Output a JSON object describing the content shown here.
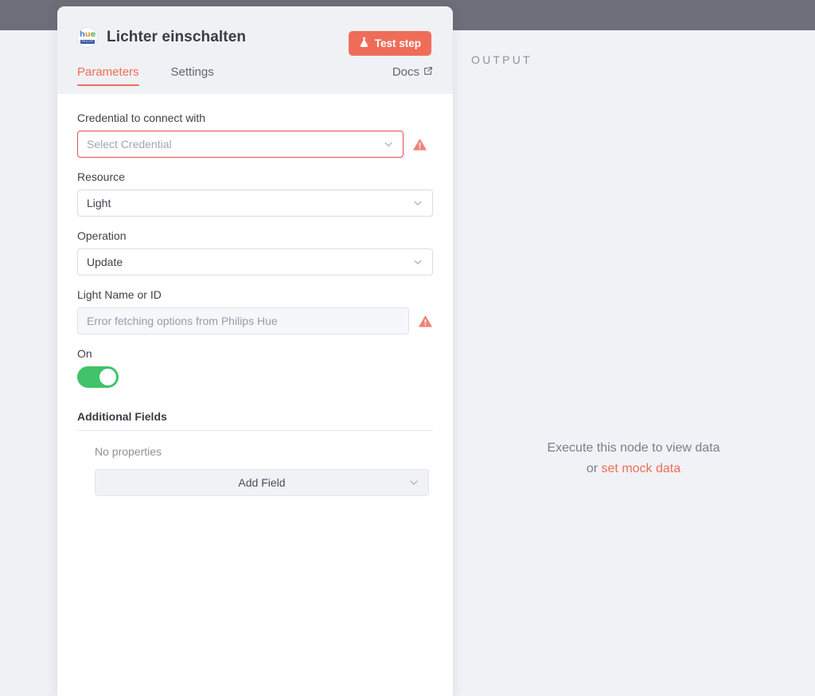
{
  "window": {
    "topbar_color": "#6e6e7a",
    "background_color": "#f0f1f5"
  },
  "node_panel": {
    "icon_name": "philips-hue-logo-icon",
    "logo_text": "hue",
    "logo_brand": "PHILIPS",
    "title": "Lichter einschalten",
    "test_step_label": "Test step",
    "test_step_color": "#ef6d58",
    "tabs": [
      {
        "label": "Parameters",
        "active": true
      },
      {
        "label": "Settings",
        "active": false
      }
    ],
    "docs_label": "Docs",
    "accent_color": "#ef6d58"
  },
  "parameters": {
    "credential": {
      "label": "Credential to connect with",
      "placeholder": "Select Credential",
      "value": "",
      "has_error": true,
      "error_color": "#ef4b4b"
    },
    "resource": {
      "label": "Resource",
      "value": "Light"
    },
    "operation": {
      "label": "Operation",
      "value": "Update"
    },
    "light_name_or_id": {
      "label": "Light Name or ID",
      "value": "Error fetching options from Philips Hue",
      "has_error": true
    },
    "on_toggle": {
      "label": "On",
      "enabled": true,
      "on_color": "#41c36a"
    },
    "additional_fields": {
      "title": "Additional Fields",
      "empty_text": "No properties",
      "add_field_label": "Add Field"
    }
  },
  "output": {
    "title": "OUTPUT",
    "empty_line1": "Execute this node to view data",
    "empty_prefix": "or ",
    "empty_link": "set mock data",
    "link_color": "#ef6d58"
  }
}
